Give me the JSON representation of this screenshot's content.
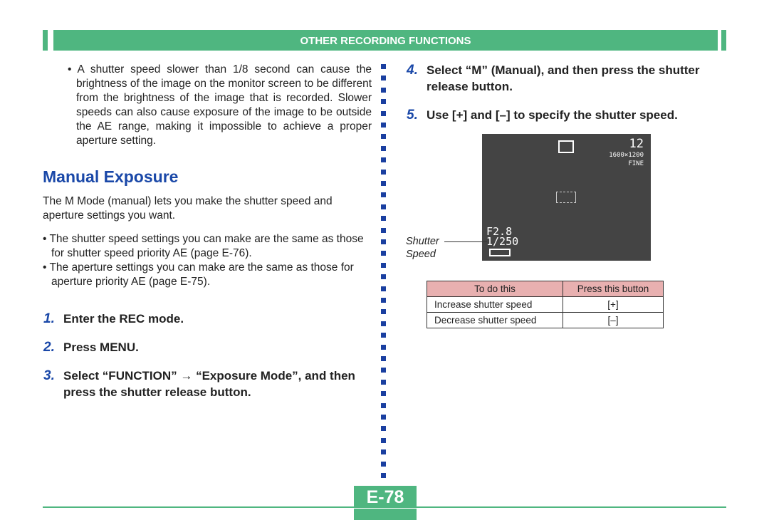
{
  "header": {
    "section_title": "OTHER RECORDING FUNCTIONS",
    "color": "#4fb680"
  },
  "left": {
    "intro_bullet": "A shutter speed slower than 1/8 second can cause the brightness of the image on the monitor screen to be different from the brightness of the image that is recorded. Slower speeds can also cause exposure of the image to be outside the AE range, making it impossible to achieve a proper aperture setting.",
    "heading": "Manual Exposure",
    "paragraph": "The M Mode (manual) lets you make the shutter speed and aperture settings you want.",
    "bullets": [
      "The shutter speed settings you can make are the same as those for shutter speed priority AE (page E-76).",
      "The aperture settings you can make are the same as those for aperture priority AE (page E-75)."
    ],
    "steps": [
      {
        "num": "1.",
        "text": "Enter the REC mode."
      },
      {
        "num": "2.",
        "text": "Press MENU."
      },
      {
        "num": "3.",
        "text": "Select “FUNCTION” → “Exposure Mode”, and then press the shutter release button."
      }
    ]
  },
  "right": {
    "steps": [
      {
        "num": "4.",
        "text": "Select “M” (Manual), and then press the shutter release button."
      },
      {
        "num": "5.",
        "text": "Use [+] and [–] to specify the shutter speed."
      }
    ],
    "screen": {
      "shots": "12",
      "size": "1600×1200",
      "quality": "FINE",
      "aperture": "F2.8",
      "shutter": "1/250"
    },
    "callout": "Shutter Speed",
    "table": {
      "headers": [
        "To do this",
        "Press this button"
      ],
      "rows": [
        [
          "Increase shutter speed",
          "[+]"
        ],
        [
          "Decrease shutter speed",
          "[–]"
        ]
      ]
    }
  },
  "page_number": "E-78"
}
